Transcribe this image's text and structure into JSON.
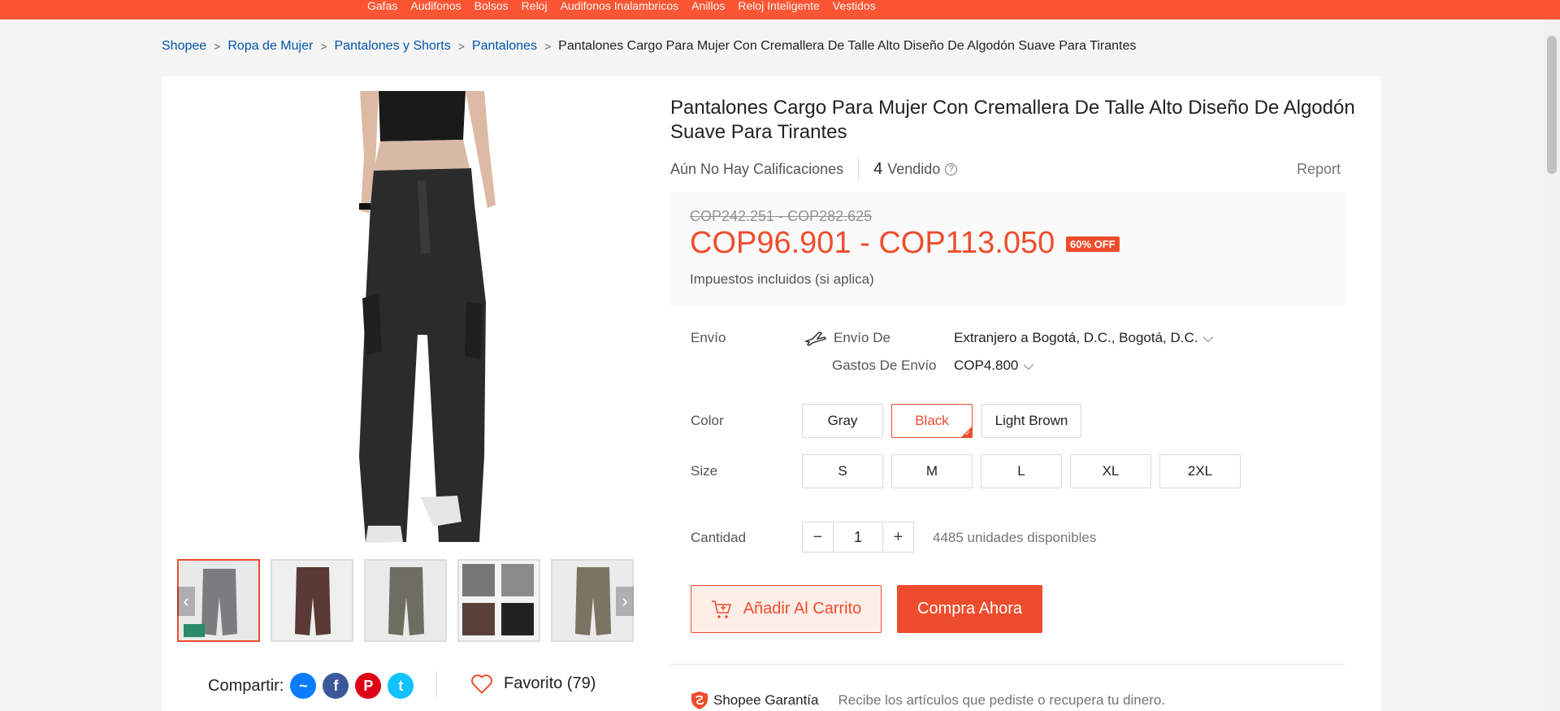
{
  "top_categories": [
    "Gafas",
    "Audifonos",
    "Bolsos",
    "Reloj",
    "Audifonos Inalambricos",
    "Anillos",
    "Reloj Inteligente",
    "Vestidos"
  ],
  "breadcrumb": {
    "items": [
      "Shopee",
      "Ropa de Mujer",
      "Pantalones y Shorts",
      "Pantalones"
    ],
    "current": "Pantalones Cargo Para Mujer Con Cremallera De Talle Alto Diseño De Algodón Suave Para Tirantes"
  },
  "product": {
    "title": "Pantalones Cargo Para Mujer Con Cremallera De Talle Alto Diseño De Algodón Suave Para Tirantes",
    "ratings_text": "Aún No Hay Calificaciones",
    "sold_count": "4",
    "sold_label": "Vendido",
    "report_label": "Report",
    "old_price": "COP242.251 - COP282.625",
    "price": "COP96.901 - COP113.050",
    "discount_badge": "60% OFF",
    "tax_note": "Impuestos incluidos (si aplica)"
  },
  "shipping": {
    "label": "Envío",
    "from_label": "Envío De",
    "from_value": "Extranjero a Bogotá, D.C., Bogotá, D.C.",
    "cost_label": "Gastos De Envío",
    "cost_value": "COP4.800"
  },
  "color": {
    "label": "Color",
    "options": [
      "Gray",
      "Black",
      "Light Brown"
    ],
    "selected": "Black"
  },
  "size": {
    "label": "Size",
    "options": [
      "S",
      "M",
      "L",
      "XL",
      "2XL"
    ]
  },
  "quantity": {
    "label": "Cantidad",
    "value": "1",
    "minus": "−",
    "plus": "+",
    "available": "4485 unidades disponibles"
  },
  "actions": {
    "add_to_cart": "Añadir Al Carrito",
    "buy_now": "Compra Ahora"
  },
  "share": {
    "label": "Compartir:",
    "networks": [
      "messenger-icon",
      "facebook-icon",
      "pinterest-icon",
      "twitter-icon"
    ]
  },
  "favorite": {
    "label": "Favorito (79)"
  },
  "guarantee": {
    "name": "Shopee Garantía",
    "description": "Recibe los artículos que pediste o recupera tu dinero."
  },
  "colors": {
    "brand": "#ee4d2d",
    "topbar": "#fb5533",
    "link": "#0055aa"
  }
}
